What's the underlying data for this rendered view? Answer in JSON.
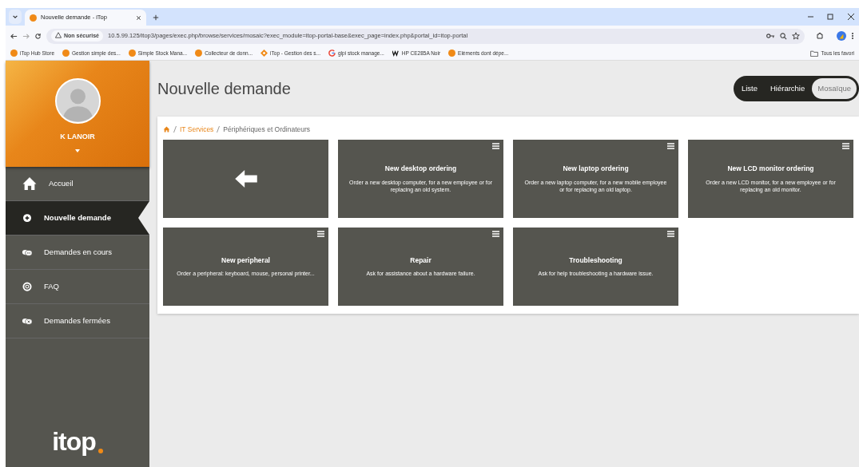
{
  "browser": {
    "tabs": [
      {
        "title": "Nouvelle demande - iTop",
        "selected": true
      }
    ],
    "security": "Non sécurisé",
    "url": "10.5.99.125/itop3/pages/exec.php/browse/services/mosaic?exec_module=itop-portal-base&exec_page=index.php&portal_id=itop-portal",
    "bookmarks": [
      {
        "label": "iTop Hub Store",
        "kind": "itop"
      },
      {
        "label": "Gestion simple des...",
        "kind": "itop"
      },
      {
        "label": "Simple Stock Mana...",
        "kind": "itop"
      },
      {
        "label": "Collecteur de donn...",
        "kind": "itop"
      },
      {
        "label": "iTop - Gestion des s...",
        "kind": "diamond"
      },
      {
        "label": "glpi stock manage...",
        "kind": "google"
      },
      {
        "label": "HP CE285A Noir",
        "kind": "w"
      },
      {
        "label": "Eléments dont dépe...",
        "kind": "itop"
      }
    ],
    "all_bookmarks": "Tous les favori"
  },
  "user": {
    "name": "K LANOIR"
  },
  "sidebar": {
    "items": [
      {
        "label": "Accueil",
        "selected": false
      },
      {
        "label": "Nouvelle demande",
        "selected": true
      },
      {
        "label": "Demandes en cours",
        "selected": false
      },
      {
        "label": "FAQ",
        "selected": false
      },
      {
        "label": "Demandes fermées",
        "selected": false
      }
    ],
    "logo": "itop"
  },
  "page_title": "Nouvelle demande",
  "view_modes": [
    {
      "label": "Liste",
      "selected": false
    },
    {
      "label": "Hiérarchie",
      "selected": false
    },
    {
      "label": "Mosaïque",
      "selected": true
    }
  ],
  "breadcrumb": [
    "IT Services",
    "Périphériques et Ordinateurs"
  ],
  "tiles": [
    {
      "kind": "back"
    },
    {
      "kind": "service",
      "title": "New desktop ordering",
      "description": "Order a new desktop computer, for a new employee or for replacing an old system."
    },
    {
      "kind": "service",
      "title": "New laptop ordering",
      "description": "Order a new laptop computer, for a new mobile employee or for replacing an old laptop."
    },
    {
      "kind": "service",
      "title": "New LCD monitor ordering",
      "description": "Order a new LCD monitor, for a new employee or for replacing an old monitor."
    },
    {
      "kind": "service",
      "title": "New peripheral",
      "description": "Order a peripheral: keyboard, mouse, personal printer..."
    },
    {
      "kind": "service",
      "title": "Repair",
      "description": "Ask for assistance about a hardware failure."
    },
    {
      "kind": "service",
      "title": "Troubleshooting",
      "description": "Ask for help troubleshooting a hardware issue."
    }
  ]
}
